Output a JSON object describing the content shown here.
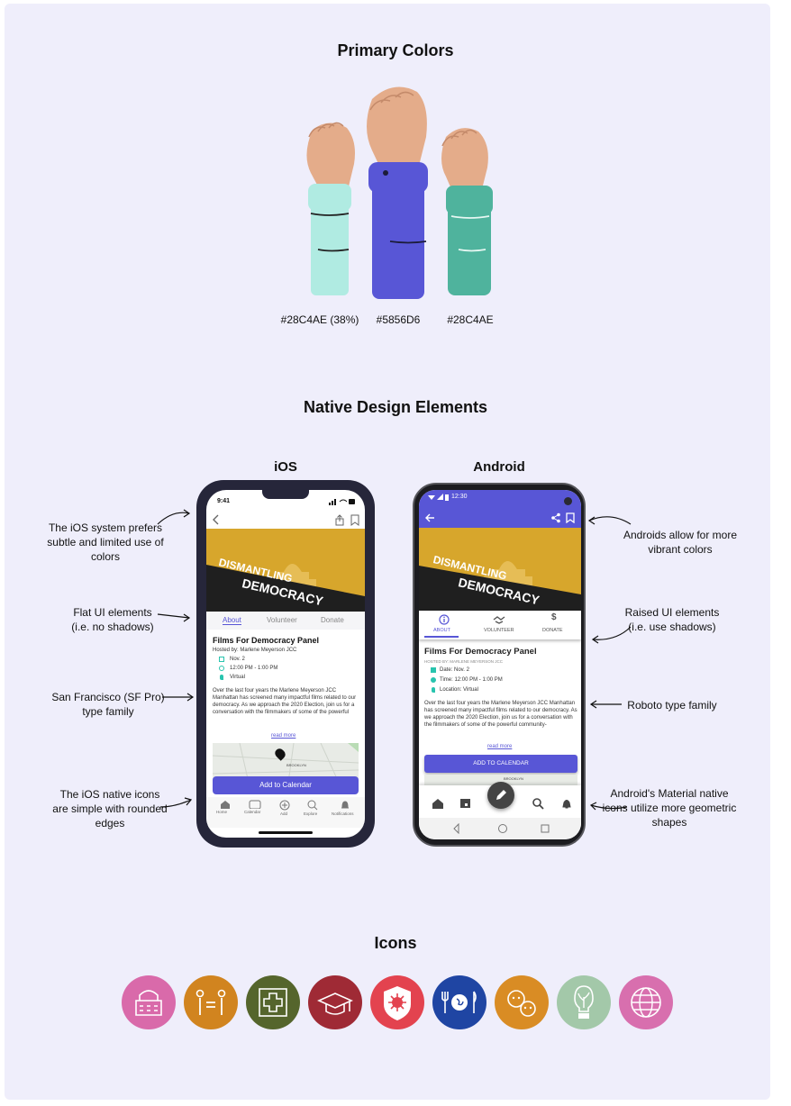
{
  "sections": {
    "primary_colors": "Primary Colors",
    "native_design": "Native Design Elements",
    "icons": "Icons"
  },
  "swatches": [
    {
      "label": "#28C4AE (38%)",
      "color": "#b0ebe2"
    },
    {
      "label": "#5856D6",
      "color": "#5856d6"
    },
    {
      "label": "#28C4AE",
      "color": "#4fb39d"
    }
  ],
  "platforms": {
    "ios": "iOS",
    "android": "Android"
  },
  "notes_left": [
    "The iOS system prefers subtle and limited use of colors",
    "Flat UI elements (i.e. no shadows)",
    "San Francisco (SF Pro) type family",
    "The iOS native icons are simple with rounded edges"
  ],
  "notes_right": [
    "Androids allow for more vibrant colors",
    "Raised UI elements (i.e. use shadows)",
    "Roboto type family",
    "Android's Material native icons utilize more geometric shapes"
  ],
  "ios": {
    "time": "9:41",
    "banner_line1": "DISMANTLING",
    "banner_line2": "DEMOCRACY",
    "tabs": [
      "About",
      "Volunteer",
      "Donate"
    ],
    "title": "Films For Democracy Panel",
    "host": "Hosted by: Marlene Meyerson JCC",
    "date": "Nov. 2",
    "time_range": "12:00 PM - 1:00 PM",
    "location": "Virtual",
    "body": "Over the last four years the Marlene Meyerson JCC Manhattan has screened many impactful films related to our democracy. As we approach the 2020 Election, join us for a conversation with the filmmakers of some of the powerful",
    "read_more": "read more",
    "map_label": "BROOKLYN",
    "cta": "Add to Calendar",
    "nav": [
      "Home",
      "Calendar",
      "Add",
      "Explore",
      "Notifications"
    ]
  },
  "android": {
    "time": "12:30",
    "banner_line1": "DISMANTLING",
    "banner_line2": "DEMOCRACY",
    "tabs": [
      "ABOUT",
      "VOLUNTEER",
      "DONATE"
    ],
    "title": "Films For Democracy Panel",
    "host": "HOSTED BY: MARLENE MEYERSON JCC",
    "date": "Date: Nov. 2",
    "time_range": "Time: 12:00 PM - 1:00 PM",
    "location": "Location: Virtual",
    "body": "Over the last four years the Marlene Meyerson JCC Manhattan has screened many impactful films related to our democracy. As we approach the 2020 Election, join us for a conversation with the filmmakers of some of the powerful community-",
    "read_more": "read more",
    "map_label": "BROOKLYN",
    "cta": "ADD TO CALENDAR"
  },
  "icons": [
    {
      "name": "government-building-icon",
      "color": "#d96aaa"
    },
    {
      "name": "equality-icon",
      "color": "#d1841f"
    },
    {
      "name": "health-cross-icon",
      "color": "#55652c"
    },
    {
      "name": "graduation-cap-icon",
      "color": "#9f2a35"
    },
    {
      "name": "virus-shield-icon",
      "color": "#e3434f"
    },
    {
      "name": "food-globe-icon",
      "color": "#1f45a3"
    },
    {
      "name": "pets-icon",
      "color": "#d98c24"
    },
    {
      "name": "lightbulb-plant-icon",
      "color": "#a3c8a9"
    },
    {
      "name": "globe-icon",
      "color": "#d86fae"
    }
  ],
  "colors": {
    "accent": "#5856D6",
    "teal": "#28C4AE",
    "banner": "#d9a82a"
  }
}
